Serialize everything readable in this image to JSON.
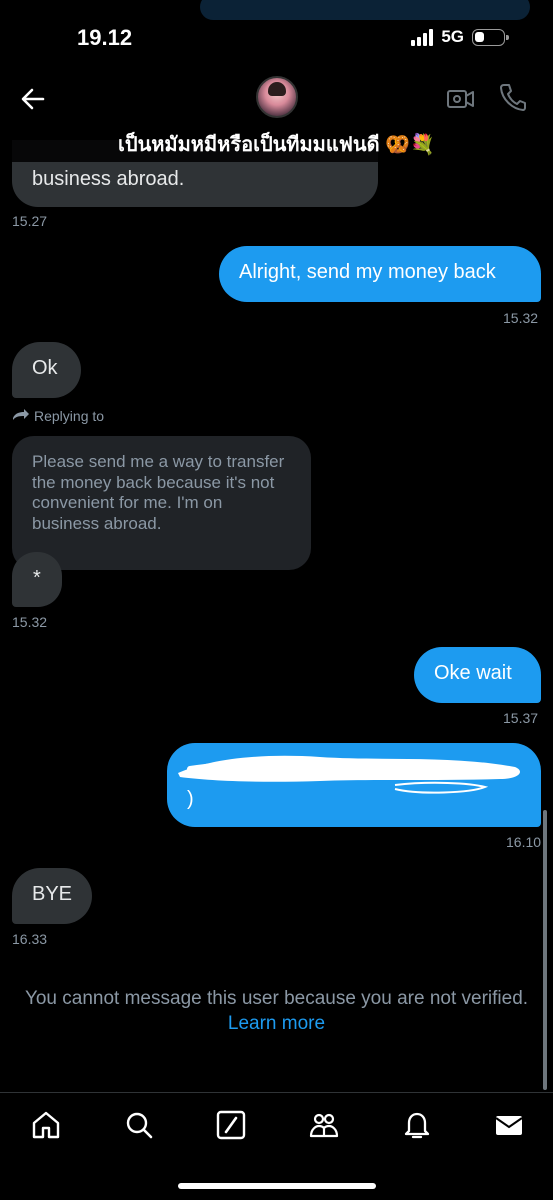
{
  "status": {
    "time": "19.12",
    "network": "5G"
  },
  "header": {
    "title": "เป็นหมัมหมีหรือเป็นทีมมแฟนดี 🥨💐"
  },
  "messages": [
    {
      "side": "recv",
      "text": "business abroad.",
      "time": "15.27"
    },
    {
      "side": "sent",
      "text": "Alright, send my money back",
      "time": "15.32"
    },
    {
      "side": "recv",
      "text": "Ok"
    },
    {
      "side": "recv",
      "reply_label": "Replying to",
      "quoted": "Please send me a way to transfer the money back because it's not convenient for me. I'm on business abroad.",
      "text": "*",
      "time": "15.32"
    },
    {
      "side": "sent",
      "text": "Oke wait",
      "time": "15.37"
    },
    {
      "side": "sent",
      "text": ")",
      "time": "16.10"
    },
    {
      "side": "recv",
      "text": "BYE",
      "time": "16.33"
    }
  ],
  "notice": {
    "text": "You cannot message this user because you are not verified.",
    "link": "Learn more"
  },
  "nav": [
    "home-icon",
    "search-icon",
    "grok-icon",
    "communities-icon",
    "notifications-icon",
    "messages-icon"
  ],
  "colors": {
    "sent_bubble": "#1d9bf0",
    "recv_bubble": "#2f3336",
    "background": "#000000",
    "link": "#1d9bf0"
  }
}
